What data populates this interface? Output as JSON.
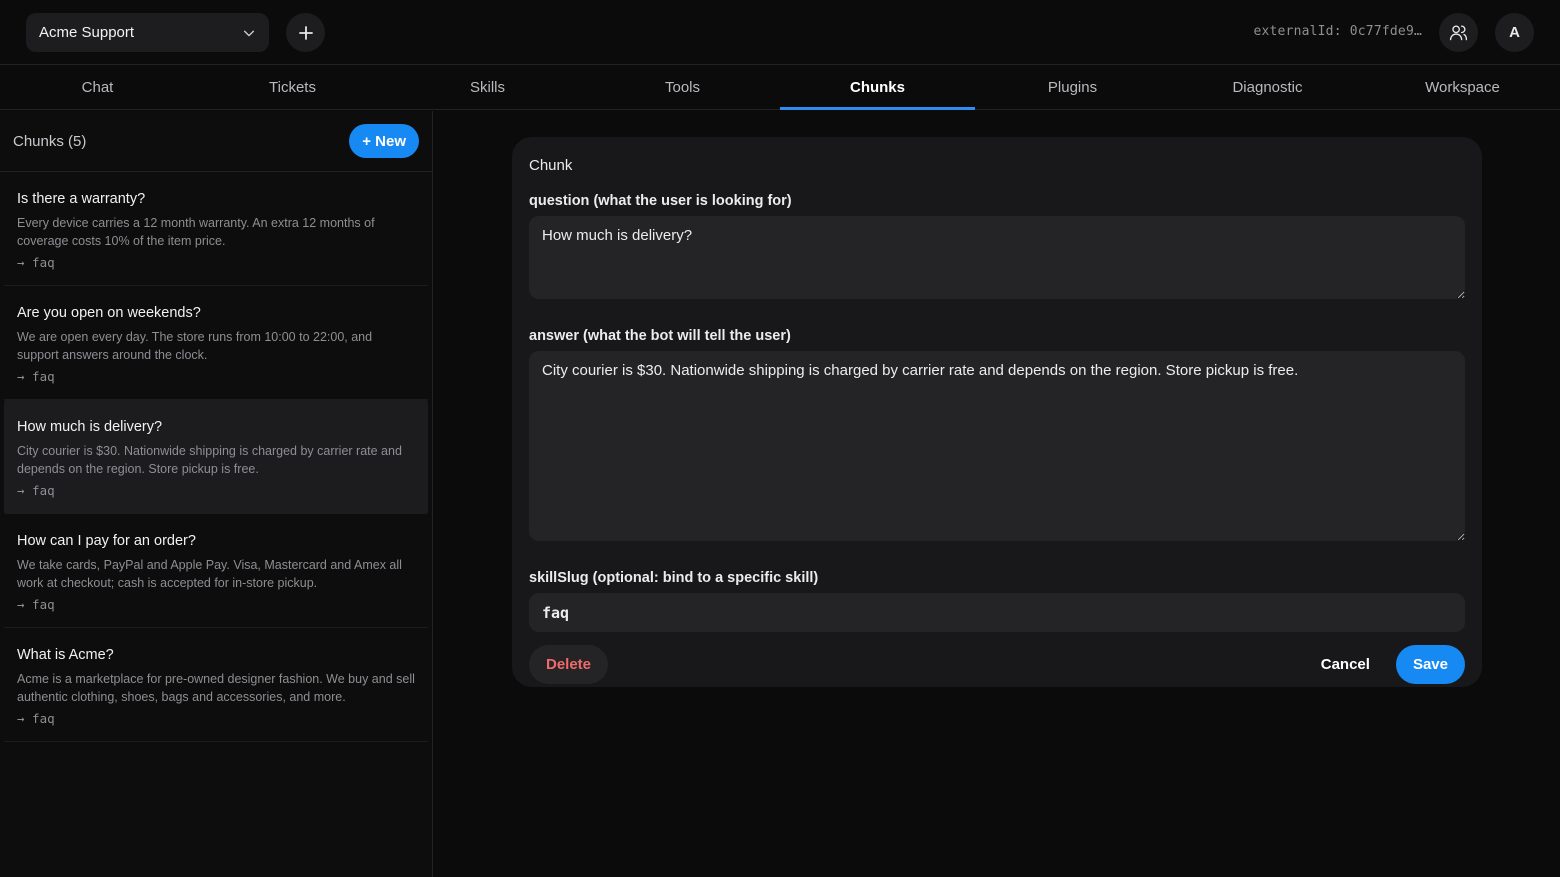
{
  "header": {
    "workspace_name": "Acme Support",
    "external_id": "externalId: 0c77fde9…",
    "avatar_initial": "A"
  },
  "tabs": [
    {
      "label": "Chat",
      "active": false
    },
    {
      "label": "Tickets",
      "active": false
    },
    {
      "label": "Skills",
      "active": false
    },
    {
      "label": "Tools",
      "active": false
    },
    {
      "label": "Chunks",
      "active": true
    },
    {
      "label": "Plugins",
      "active": false
    },
    {
      "label": "Diagnostic",
      "active": false
    },
    {
      "label": "Workspace",
      "active": false
    }
  ],
  "sidebar": {
    "title": "Chunks (5)",
    "new_label": "+ New",
    "items": [
      {
        "question": "Is there a warranty?",
        "answer": "Every device carries a 12 month warranty. An extra 12 months of coverage costs 10% of the item price.",
        "skill": "→ faq"
      },
      {
        "question": "Are you open on weekends?",
        "answer": "We are open every day. The store runs from 10:00 to 22:00, and support answers around the clock.",
        "skill": "→ faq"
      },
      {
        "question": "How much is delivery?",
        "answer": "City courier is $30. Nationwide shipping is charged by carrier rate and depends on the region. Store pickup is free.",
        "skill": "→ faq"
      },
      {
        "question": "How can I pay for an order?",
        "answer": "We take cards, PayPal and Apple Pay. Visa, Mastercard and Amex all work at checkout; cash is accepted for in-store pickup.",
        "skill": "→ faq"
      },
      {
        "question": "What is Acme?",
        "answer": "Acme is a marketplace for pre-owned designer fashion. We buy and sell authentic clothing, shoes, bags and accessories, and more.",
        "skill": "→ faq"
      }
    ],
    "selected_index": 2
  },
  "editor": {
    "title": "Chunk",
    "question_label": "question (what the user is looking for)",
    "question_value": "How much is delivery?",
    "answer_label": "answer (what the bot will tell the user)",
    "answer_value": "City courier is $30. Nationwide shipping is charged by carrier rate and depends on the region. Store pickup is free.",
    "skill_label": "skillSlug (optional: bind to a specific skill)",
    "skill_value": "faq",
    "delete_label": "Delete",
    "cancel_label": "Cancel",
    "save_label": "Save"
  },
  "icons": {
    "workspace_dropdown": "chevron-down-icon",
    "add": "plus-icon",
    "users": "users-icon"
  },
  "colors": {
    "accent": "#1789f2",
    "danger": "#f06a6a"
  }
}
